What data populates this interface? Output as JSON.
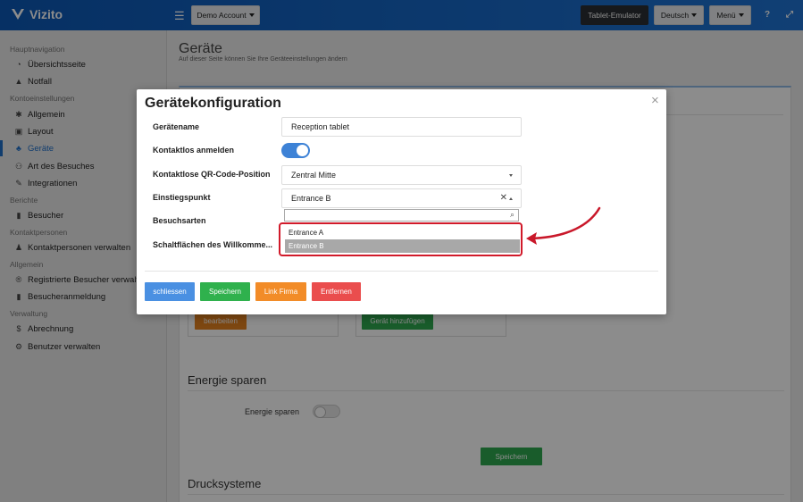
{
  "header": {
    "logo_text": "Vizito",
    "account_label": "Demo Account",
    "tablet_emulator_label": "Tablet-Emulator",
    "language_label": "Deutsch",
    "menu_label": "Menü",
    "help_icon": "?",
    "expand_icon": "⤢"
  },
  "sidebar": {
    "sections": [
      {
        "title": "Hauptnavigation",
        "items": [
          {
            "label": "Übersichtsseite",
            "icon": "dashboard-icon"
          },
          {
            "label": "Notfall",
            "icon": "warning-icon"
          }
        ]
      },
      {
        "title": "Kontoeinstellungen",
        "items": [
          {
            "label": "Allgemein",
            "icon": "gear-icon"
          },
          {
            "label": "Layout",
            "icon": "image-icon"
          },
          {
            "label": "Geräte",
            "icon": "sitemap-icon",
            "active": true
          },
          {
            "label": "Art des Besuches",
            "icon": "users-icon"
          },
          {
            "label": "Integrationen",
            "icon": "plug-icon"
          }
        ]
      },
      {
        "title": "Berichte",
        "items": [
          {
            "label": "Besucher",
            "icon": "book-icon"
          }
        ]
      },
      {
        "title": "Kontaktpersonen",
        "items": [
          {
            "label": "Kontaktpersonen verwalten",
            "icon": "person-icon"
          }
        ]
      },
      {
        "title": "Allgemein",
        "items": [
          {
            "label": "Registrierte Besucher verwalten",
            "icon": "registered-icon"
          },
          {
            "label": "Besucheranmeldung",
            "icon": "book-icon"
          }
        ]
      },
      {
        "title": "Verwaltung",
        "items": [
          {
            "label": "Abrechnung",
            "icon": "dollar-icon"
          },
          {
            "label": "Benutzer verwalten",
            "icon": "user-cog-icon"
          }
        ]
      }
    ]
  },
  "page": {
    "title": "Geräte",
    "subtitle": "Auf dieser Seite können Sie Ihre Geräteeinstellungen ändern",
    "edit_label": "bearbeiten",
    "add_device_label": "Gerät hinzufügen",
    "energy_heading": "Energie sparen",
    "energy_label": "Energie sparen",
    "save_label": "Speichern",
    "print_heading": "Drucksysteme"
  },
  "modal": {
    "title": "Gerätekonfiguration",
    "close_icon": "×",
    "fields": {
      "device_name_label": "Gerätename",
      "device_name_value": "Reception tablet",
      "contactless_label": "Kontaktlos anmelden",
      "contactless_on": true,
      "qr_label": "Kontaktlose QR-Code-Position",
      "qr_value": "Zentral Mitte",
      "entry_label": "Einstiegspunkt",
      "entry_value": "Entrance B",
      "visit_types_label": "Besuchsarten",
      "welcome_buttons_label": "Schaltflächen des Willkomme..."
    },
    "dropdown": {
      "search_value": "",
      "options": [
        "Entrance A",
        "Entrance B"
      ],
      "highlighted": "Entrance B"
    },
    "buttons": {
      "close": "schliessen",
      "save": "Speichern",
      "link_company": "Link Firma",
      "remove": "Entfernen"
    }
  },
  "colors": {
    "topbar": "#1565c0",
    "primary_blue": "#4a90e2",
    "green": "#28a745",
    "orange": "#f28c28",
    "red": "#e74c4c",
    "highlight_red": "#d11a2a"
  }
}
